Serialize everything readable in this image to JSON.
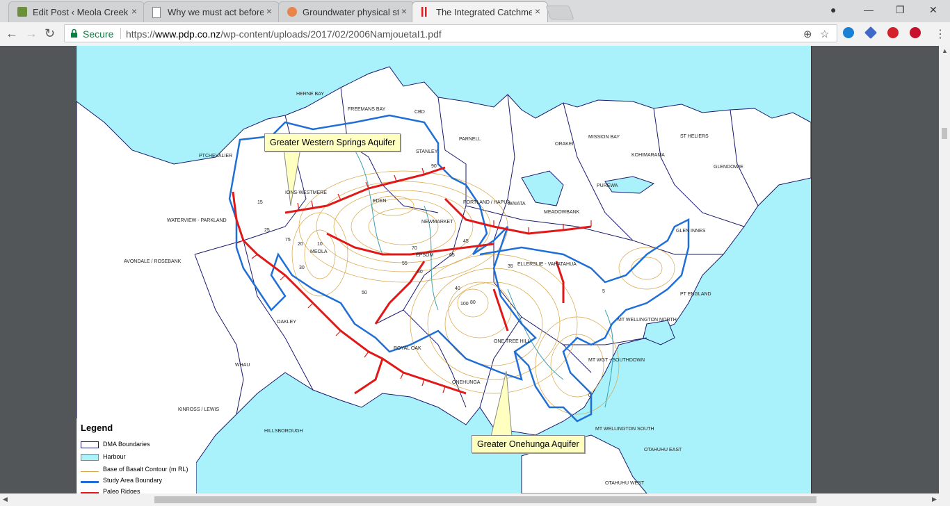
{
  "browser": {
    "tabs": [
      {
        "title": "Edit Post ‹ Meola Creek –",
        "icon": "wordpress-icon",
        "color": "#6b8f3a",
        "active": false
      },
      {
        "title": "Why we must act before",
        "icon": "page-icon",
        "color": "#888888",
        "active": false
      },
      {
        "title": "Groundwater physical sta",
        "icon": "orange-dot-icon",
        "color": "#e8844c",
        "active": false
      },
      {
        "title": "The Integrated Catchmen",
        "icon": "pdf-icon",
        "color": "#e02020",
        "active": true
      }
    ],
    "close_glyph": "×",
    "window_controls": {
      "account": "●",
      "minimize": "—",
      "restore": "❐",
      "close": "✕"
    },
    "nav": {
      "back": "←",
      "forward": "→",
      "reload": "↻"
    },
    "omnibox": {
      "secure_label": "Secure",
      "url_scheme": "https://",
      "url_host": "www.pdp.co.nz",
      "url_path": "/wp-content/uploads/2017/02/2006NamjouetaI1.pdf"
    },
    "toolbar_icons": [
      "zoom-icon",
      "star-icon",
      "hp-icon",
      "extension-icon",
      "pinterest-icon",
      "lastpass-icon",
      "menu-icon"
    ]
  },
  "map": {
    "colors": {
      "harbour": "#a9f2fb",
      "land": "#ffffff",
      "dma_boundary": "#1a1a6e",
      "study_area": "#1f6fd6",
      "paleo_ridge": "#e01818",
      "contour": "#d9a441",
      "stream": "#3a9fb0"
    },
    "place_labels": [
      {
        "id": "herne-bay",
        "text": "HERNE BAY"
      },
      {
        "id": "freemans-bay",
        "text": "FREEMANS BAY"
      },
      {
        "id": "cbd",
        "text": "CBD"
      },
      {
        "id": "parnell",
        "text": "PARNELL"
      },
      {
        "id": "stanley",
        "text": "STANLEY"
      },
      {
        "id": "orakei",
        "text": "ORAKEI"
      },
      {
        "id": "mission-bay",
        "text": "MISSION BAY"
      },
      {
        "id": "st-heliers",
        "text": "ST HELIERS"
      },
      {
        "id": "kohimarama",
        "text": "KOHIMARAMA"
      },
      {
        "id": "glendowie",
        "text": "GLENDOWIE"
      },
      {
        "id": "purewa",
        "text": "PUREWA"
      },
      {
        "id": "ptchevalier",
        "text": "PTCHEVALIER"
      },
      {
        "id": "kingsland-westmere",
        "text": "IONS-WESTMERE"
      },
      {
        "id": "eden",
        "text": "EDEN"
      },
      {
        "id": "portland-hapua",
        "text": "PORTLAND / HAPUA"
      },
      {
        "id": "waiata",
        "text": "WAIATA"
      },
      {
        "id": "meadowbank",
        "text": "MEADOWBANK"
      },
      {
        "id": "waterview-parkland",
        "text": "WATERVIEW - PARKLAND"
      },
      {
        "id": "newmarket",
        "text": "NEWMARKET"
      },
      {
        "id": "glen-innes",
        "text": "GLEN INNES"
      },
      {
        "id": "avondale-rosebank",
        "text": "AVONDALE / ROSEBANK"
      },
      {
        "id": "meola",
        "text": "MEOLA"
      },
      {
        "id": "epsom",
        "text": "EPSOM"
      },
      {
        "id": "ellerslie-vahatahua",
        "text": "ELLERSLIE - VAHATAHUA"
      },
      {
        "id": "pt-england",
        "text": "PT ENGLAND"
      },
      {
        "id": "oakley",
        "text": "OAKLEY"
      },
      {
        "id": "mt-wellington-north",
        "text": "MT WELLINGTON NORTH"
      },
      {
        "id": "one-tree-hill",
        "text": "ONE TREE HILL"
      },
      {
        "id": "royal-oak",
        "text": "ROYAL OAK"
      },
      {
        "id": "whau",
        "text": "WHAU"
      },
      {
        "id": "mt-wgt-southdown",
        "text": "MT WGT - SOUTHDOWN"
      },
      {
        "id": "onehunga",
        "text": "ONEHUNGA"
      },
      {
        "id": "kinross-lewis",
        "text": "KINROSS / LEWIS"
      },
      {
        "id": "hillsborough",
        "text": "HILLSBOROUGH"
      },
      {
        "id": "mt-wellington-south",
        "text": "MT WELLINGTON SOUTH"
      },
      {
        "id": "otahuhu-east",
        "text": "OTAHUHU EAST"
      },
      {
        "id": "otahuhu-west",
        "text": "OTAHUHU WEST"
      }
    ],
    "contour_values": [
      "75",
      "70",
      "65",
      "60",
      "55",
      "50",
      "45",
      "40",
      "35",
      "30",
      "25",
      "20",
      "15",
      "10",
      "5",
      "0",
      "80",
      "90",
      "100"
    ],
    "callouts": {
      "western_springs": "Greater Western Springs Aquifer",
      "onehunga": "Greater Onehunga Aquifer"
    },
    "legend": {
      "title": "Legend",
      "items": [
        "DMA Boundaries",
        "Harbour",
        "Base of Basalt Contour (m RL)",
        "Study Area Boundary",
        "Paleo Ridges"
      ]
    }
  }
}
